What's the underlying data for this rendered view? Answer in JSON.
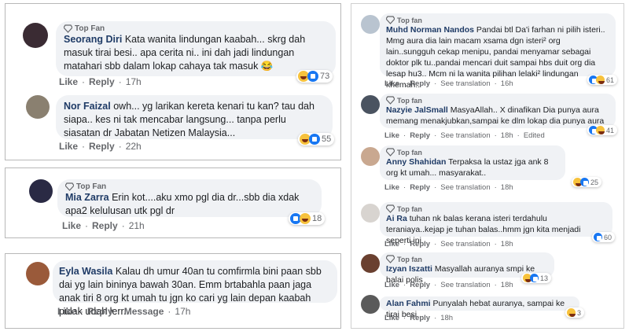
{
  "labels": {
    "top_fan_a": "Top Fan",
    "top_fan_b": "Top fan",
    "like": "Like",
    "reply": "Reply",
    "message": "Message",
    "see_translation": "See translation",
    "edited": "Edited",
    "sep": "·"
  },
  "colors": {
    "name": "#1f3b66",
    "bubble": "#f0f2f5",
    "like_blue": "#1877f2",
    "haha_yellow": "#f7c23c"
  },
  "left": [
    {
      "name": "Seorang Diri",
      "badge": "Top Fan",
      "text": "Kata wanita lindungan kaabah... skrg dah masuk tirai besi.. apa cerita ni.. ini dah jadi lindungan matahari sbb dalam lokap cahaya tak masuk 😂",
      "time": "17h",
      "reactions": "73"
    },
    {
      "name": "Nor Faizal",
      "badge": "",
      "text": "owh... yg larikan kereta kenari tu kan? tau dah siapa.. kes ni tak mencabar langsung... tanpa perlu siasatan dr Jabatan Netizen Malaysia...",
      "time": "22h",
      "reactions": "55"
    },
    {
      "name": "Mia Zarra",
      "badge": "Top Fan",
      "text": "Erin kot....aku xmo pgl dia dr...sbb dia xdak apa2 kelulusan utk pgl dr",
      "time": "21h",
      "reactions": "18"
    },
    {
      "name": "Eyla Wasila",
      "badge": "",
      "text": "Kalau dh umur 40an tu comfirmla bini paan sbb dai yg lain bininya bawah 30an. Emm brtabahla paan jaga anak tiri 8 org kt umah tu jgn ko cari yg lain depan kaabah pulak udah lerr..",
      "time": "17h",
      "reactions": ""
    }
  ],
  "right": [
    {
      "name": "Muhd Norman Nandos",
      "badge": "Top fan",
      "text": "Pandai btl Da'i farhan ni pilih isteri.. Mmg aura dia lain macam xsama dgn isteri² org lain..sungguh cekap menipu, pandai menyamar sebagai doktor plk tu..pandai mencari duit sampai hbs duit org dia lesap hu3.. Mcm ni la wanita pilihan lelaki² lindungan khemah..",
      "time": "16h",
      "reactions": "61",
      "extra": ""
    },
    {
      "name": "Nazyie JalSmall",
      "badge": "Top fan",
      "text": "MasyaAllah.. X dinafikan Dia punya aura memang menakjubkan,sampai ke dlm lokap dia punya aura",
      "time": "18h",
      "reactions": "41",
      "extra": "Edited"
    },
    {
      "name": "Anny Shahidan",
      "badge": "Top fan",
      "text": "Terpaksa la ustaz jga ank 8 org kt umah... masyarakat..",
      "time": "18h",
      "reactions": "25",
      "extra": ""
    },
    {
      "name": "Ai Ra",
      "badge": "Top fan",
      "text": "tuhan nk balas kerana isteri terdahulu teraniaya..kejap je tuhan balas..hmm jgn kita menjadi seperti ini..",
      "time": "18h",
      "reactions": "60",
      "extra": ""
    },
    {
      "name": "Izyan Iszatti",
      "badge": "Top fan",
      "text": "Masyallah auranya smpi ke balai polis",
      "time": "18h",
      "reactions": "13",
      "extra": ""
    },
    {
      "name": "Alan Fahmi",
      "badge": "",
      "text": "Punyalah hebat auranya, sampai ke tirai besi...",
      "time": "18h",
      "reactions": "3",
      "extra": ""
    }
  ]
}
